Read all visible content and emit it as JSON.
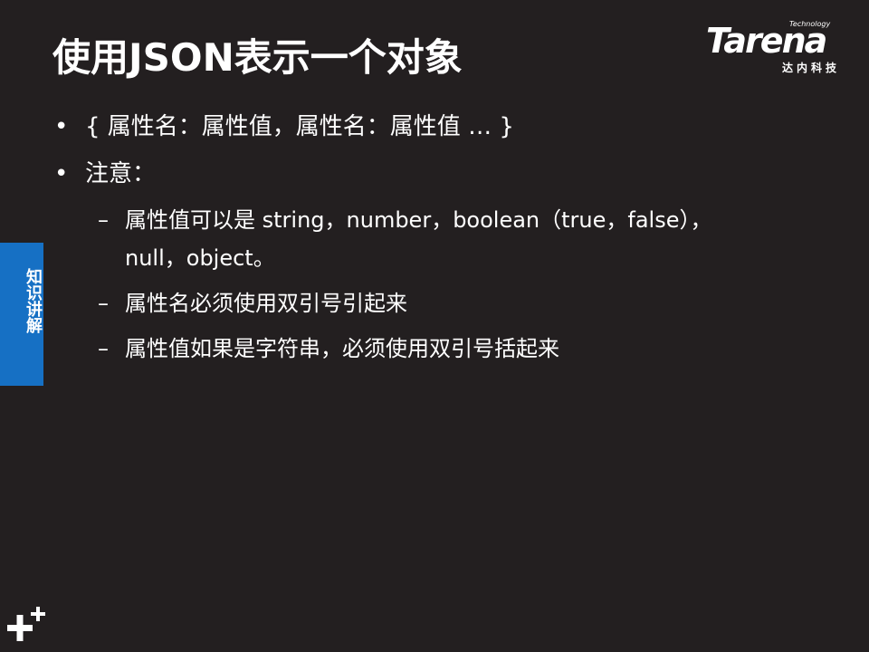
{
  "title": "使用JSON表示一个对象",
  "logo": {
    "small_text": "Technology",
    "word": "Tarena",
    "cn": "达内科技"
  },
  "side_tab": "知识讲解",
  "bullets": [
    {
      "text": "{ 属性名：属性值，属性名：属性值 … }"
    },
    {
      "text": "注意："
    }
  ],
  "sub_bullets": [
    "属性值可以是 string，number，boolean（true，false），null，object。",
    "属性名必须使用双引号引起来",
    "属性值如果是字符串，必须使用双引号括起来"
  ],
  "icons": {
    "bullet": "bullet-dot-icon",
    "dash": "dash-icon",
    "corner": "plus-icon"
  }
}
